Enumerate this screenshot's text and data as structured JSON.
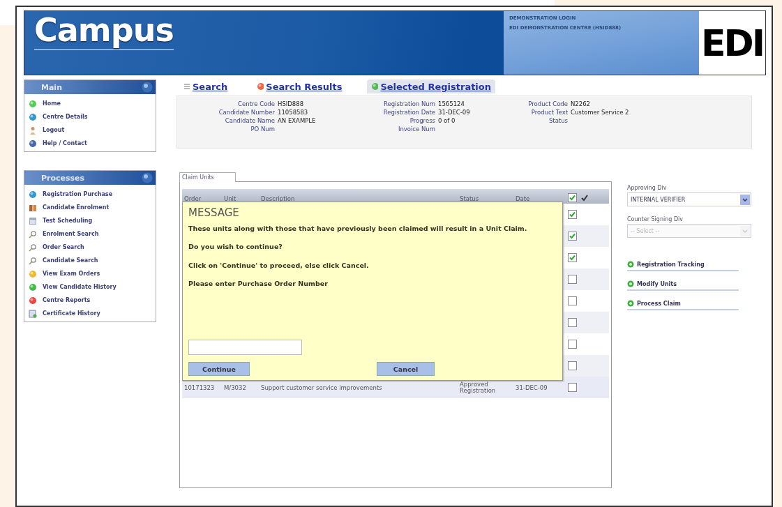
{
  "header": {
    "logo": "Campus",
    "login_lines": [
      "DEMONSTRATION LOGIN",
      "EDI DEMONSTRATION CENTRE (HSID888)"
    ],
    "brand": "EDI"
  },
  "sidebar": {
    "panels": [
      {
        "title": "Main",
        "items": [
          {
            "label": "Home"
          },
          {
            "label": "Centre Details"
          },
          {
            "label": "Logout"
          },
          {
            "label": "Help / Contact"
          }
        ]
      },
      {
        "title": "Processes",
        "items": [
          {
            "label": "Registration Purchase"
          },
          {
            "label": "Candidate Enrolment"
          },
          {
            "label": "Test Scheduling"
          },
          {
            "label": "Enrolment Search"
          },
          {
            "label": "Order Search"
          },
          {
            "label": "Candidate Search"
          },
          {
            "label": "View Exam Orders"
          },
          {
            "label": "View Candidate History"
          },
          {
            "label": "Centre Reports"
          },
          {
            "label": "Certificate History"
          }
        ]
      }
    ]
  },
  "tabs": [
    {
      "label": "Search",
      "selected": false
    },
    {
      "label": "Search Results",
      "selected": false
    },
    {
      "label": "Selected Registration",
      "selected": true
    }
  ],
  "registration": {
    "columns": [
      [
        {
          "label": "Centre Code",
          "value": "HSID888"
        },
        {
          "label": "Candidate Number",
          "value": "11058583"
        },
        {
          "label": "Candidate Name",
          "value": "AN EXAMPLE"
        },
        {
          "label": "PO Num"
        }
      ],
      [
        {
          "label": "Registration Num",
          "value": "1565124"
        },
        {
          "label": "Registration Date",
          "value": "31-DEC-09"
        },
        {
          "label": "Progress",
          "value": "0 of 0"
        },
        {
          "label": "Invoice Num"
        }
      ],
      [
        {
          "label": "Product Code",
          "value": "N2262"
        },
        {
          "label": "Product Text",
          "value": "Customer Service 2"
        },
        {
          "label": "Status"
        }
      ]
    ]
  },
  "claim_units": {
    "tab_label": "Claim Units",
    "columns": [
      "Order",
      "Unit",
      "Description",
      "Status",
      "Date"
    ],
    "select_all_checked": true,
    "rows": [
      {
        "checked": true
      },
      {
        "checked": true
      },
      {
        "checked": true
      },
      {
        "checked": false
      },
      {
        "checked": false
      },
      {
        "checked": false
      },
      {
        "checked": false
      },
      {
        "checked": false
      },
      {
        "order": "10171323",
        "unit": "M/3032",
        "description": "Support customer service improvements",
        "status": "Approved Registration",
        "date": "31-DEC-09",
        "checked": false
      }
    ]
  },
  "dialog": {
    "title": "MESSAGE",
    "paragraphs": [
      "These units along with those that have previously been claimed will result in a Unit Claim.",
      "Do you wish to continue?",
      "Click on 'Continue' to proceed, else click Cancel.",
      "Please enter Purchase Order Number"
    ],
    "buttons": [
      "Continue",
      "Cancel"
    ]
  },
  "claim_form": {
    "fields": [
      {
        "label": "Approving Div",
        "value": "INTERNAL VERIFIER",
        "disabled": false
      },
      {
        "label": "Counter Signing Div",
        "placeholder": "-- Select --",
        "disabled": true
      }
    ],
    "links": [
      {
        "label": "Registration Tracking"
      },
      {
        "label": "Modify Units"
      },
      {
        "label": "Process Claim"
      }
    ]
  }
}
